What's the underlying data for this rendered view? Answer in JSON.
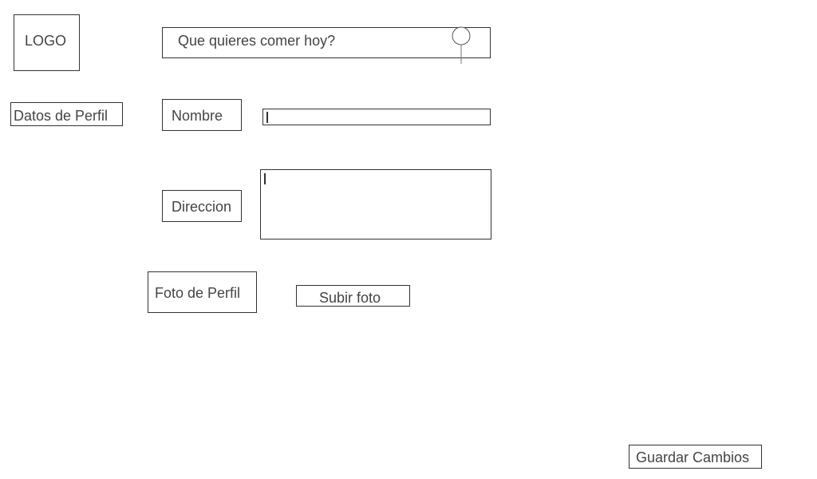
{
  "logo": {
    "text": "LOGO"
  },
  "search": {
    "text": "Que quieres comer hoy?",
    "icon": "search-icon"
  },
  "sidebar": {
    "profile_data_label": "Datos de Perfil"
  },
  "form": {
    "name_label": "Nombre",
    "name_value": "",
    "address_label": "Direccion",
    "address_value": "",
    "photo_label": "Foto de Perfil",
    "upload_button": "Subir foto"
  },
  "footer": {
    "save_button": "Guardar Cambios"
  }
}
